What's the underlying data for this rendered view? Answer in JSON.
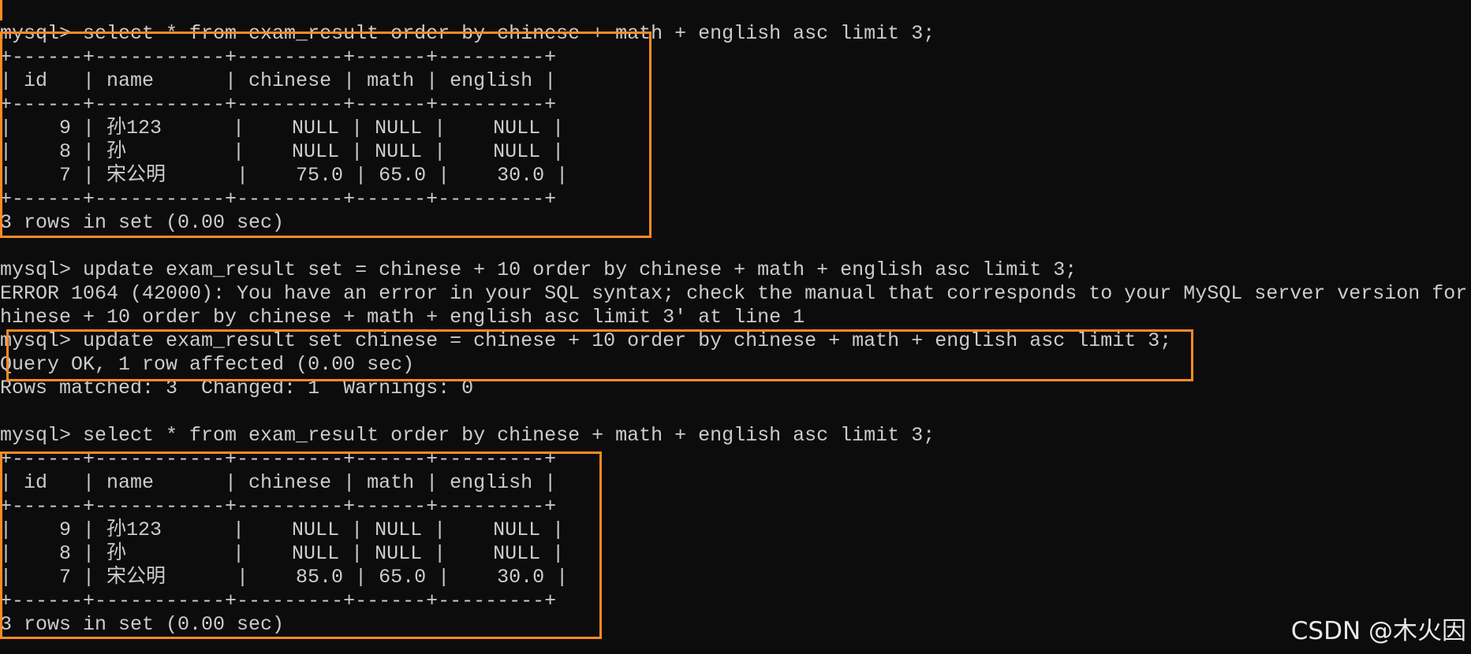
{
  "terminal": {
    "lines": [
      "mysql> select * from exam_result order by chinese + math + english asc limit 3;",
      "+------+-----------+---------+------+---------+",
      "| id   | name      | chinese | math | english |",
      "+------+-----------+---------+------+---------+",
      "|    9 | 孙123      |    NULL | NULL |    NULL |",
      "|    8 | 孙         |    NULL | NULL |    NULL |",
      "|    7 | 宋公明      |    75.0 | 65.0 |    30.0 |",
      "+------+-----------+---------+------+---------+",
      "3 rows in set (0.00 sec)",
      "",
      "mysql> update exam_result set = chinese + 10 order by chinese + math + english asc limit 3;",
      "ERROR 1064 (42000): You have an error in your SQL syntax; check the manual that corresponds to your MySQL server version for",
      "hinese + 10 order by chinese + math + english asc limit 3' at line 1",
      "mysql> update exam_result set chinese = chinese + 10 order by chinese + math + english asc limit 3;",
      "Query OK, 1 row affected (0.00 sec)",
      "Rows matched: 3  Changed: 1  Warnings: 0",
      "",
      "mysql> select * from exam_result order by chinese + math + english asc limit 3;",
      "+------+-----------+---------+------+---------+",
      "| id   | name      | chinese | math | english |",
      "+------+-----------+---------+------+---------+",
      "|    9 | 孙123      |    NULL | NULL |    NULL |",
      "|    8 | 孙         |    NULL | NULL |    NULL |",
      "|    7 | 宋公明      |    85.0 | 65.0 |    30.0 |",
      "+------+-----------+---------+------+---------+",
      "3 rows in set (0.00 sec)"
    ]
  },
  "watermark": "CSDN @木火因",
  "colors": {
    "background": "#0c0c0c",
    "text": "#cccccc",
    "highlight": "#ff8a24"
  }
}
